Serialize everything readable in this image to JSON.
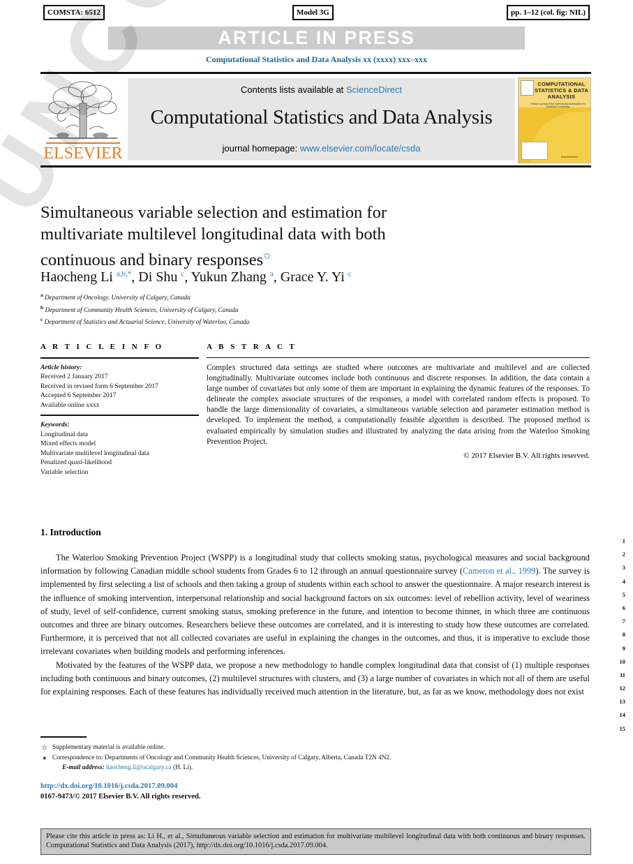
{
  "stamps": {
    "left": "COMSTA: 6512",
    "middle": "Model 3G",
    "right": "pp. 1–12 (col. fig: NIL)"
  },
  "banner": {
    "text": "ARTICLE IN PRESS",
    "journal_ref": "Computational Statistics and Data Analysis xx (xxxx) xxx–xxx"
  },
  "masthead": {
    "contents_prefix": "Contents lists available at ",
    "contents_link": "ScienceDirect",
    "journal_title": "Computational Statistics and Data Analysis",
    "homepage_prefix": "journal homepage: ",
    "homepage_link": "www.elsevier.com/locate/csda",
    "publisher": "ELSEVIER",
    "cover_title": "COMPUTATIONAL STATISTICS & DATA ANALYSIS",
    "cover_sub": "Official Journal of the International Association for Statistical Computing",
    "cover_foot": "ScienceDirect"
  },
  "article": {
    "title": "Simultaneous variable selection and estimation for multivariate multilevel longitudinal data with both continuous and binary responses",
    "title_marker": "✩",
    "authors_html": "Haocheng Li <sup>a,b,*</sup>, Di Shu <sup>c</sup>, Yukun Zhang <sup>a</sup>, Grace Y. Yi <sup>c</sup>",
    "affiliations": [
      {
        "mark": "a",
        "text": "Department of Oncology, University of Calgary, Canada"
      },
      {
        "mark": "b",
        "text": "Department of Community Health Sciences, University of Calgary, Canada"
      },
      {
        "mark": "c",
        "text": "Department of Statistics and Actuarial Science, University of Waterloo, Canada"
      }
    ]
  },
  "info": {
    "heading": "A R T I C L E   I N F O",
    "history_label": "Article history:",
    "history": [
      "Received 2 January 2017",
      "Received in revised form 6 September 2017",
      "Accepted 6 September 2017",
      "Available online xxxx"
    ],
    "keywords_label": "Keywords:",
    "keywords": [
      "Longitudinal data",
      "Mixed effects model",
      "Multivariate multilevel longitudinal data",
      "Penalized quasi-likelihood",
      "Variable selection"
    ]
  },
  "abstract": {
    "heading": "A B S T R A C T",
    "text": "Complex structured data settings are studied where outcomes are multivariate and multilevel and are collected longitudinally. Multivariate outcomes include both continuous and discrete responses. In addition, the data contain a large number of covariates but only some of them are important in explaining the dynamic features of the responses. To delineate the complex associate structures of the responses, a model with correlated random effects is proposed. To handle the large dimensionality of covariates, a simultaneous variable selection and parameter estimation method is developed. To implement the method, a computationally feasible algorithm is described. The proposed method is evaluated empirically by simulation studies and illustrated by analyzing the data arising from the Waterloo Smoking Prevention Project.",
    "copyright": "© 2017 Elsevier B.V. All rights reserved."
  },
  "body": {
    "section_title": "1. Introduction",
    "paragraph1_a": "The Waterloo Smoking Prevention Project (WSPP) is a longitudinal study that collects smoking status, psychological measures and social background information by following Canadian middle school students from Grades 6 to 12 through an annual questionnaire survey  (",
    "paragraph1_cite": "Cameron et al., 1999",
    "paragraph1_b": "). The survey is implemented by first selecting a list of schools and then taking a group of students within each school to answer the questionnaire. A major research interest is the influence of smoking intervention, interpersonal relationship and social background factors on six outcomes: level of rebellion activity, level of weariness of study, level of self-confidence, current smoking status, smoking preference in the future, and intention to become thinner, in which three are continuous outcomes and three are binary outcomes. Researchers believe these outcomes are correlated, and it is interesting to study how these outcomes are correlated. Furthermore, it is perceived that not all collected covariates are useful in explaining the changes in the outcomes, and thus, it is imperative to exclude those irrelevant covariates when building models and performing inferences.",
    "paragraph2": "Motivated by the features of the WSPP data, we propose a new methodology to handle complex longitudinal data that consist of (1) multiple responses including both continuous and binary outcomes, (2) multilevel structures with clusters, and (3) a large number of covariates in which not all of them are useful for explaining responses. Each of these features has individually received much attention in the literature, but, as far as we know, methodology does not exist",
    "line_numbers": [
      "1",
      "2",
      "3",
      "4",
      "5",
      "6",
      "7",
      "8",
      "9",
      "10",
      "11",
      "12",
      "13",
      "14",
      "15"
    ]
  },
  "footnotes": {
    "star_mark": "✩",
    "star_text": "Supplementary material is available online.",
    "corr_mark": "∗",
    "corr_text": "Correspondence to: Departments of Oncology and Community Health Sciences, University of Calgary, Alberta, Canada T2N 4N2.",
    "email_label": "E-mail address:",
    "email": "haocheng.li@ucalgary.ca",
    "email_suffix": "(H. Li).",
    "doi": "http://dx.doi.org/10.1016/j.csda.2017.09.004",
    "issn": "0167-9473/© 2017 Elsevier B.V. All rights reserved."
  },
  "cite_box": {
    "text": "Please cite this article in press as: Li H., et al., Simultaneous variable selection and estimation for multivariate multilevel longitudinal data with both continuous and binary responses. Computational Statistics and Data Analysis (2017), http://dx.doi.org/10.1016/j.csda.2017.09.004."
  },
  "watermark": {
    "text": "UNCORRECTED PROOF"
  },
  "colors": {
    "link": "#2a7ab0",
    "banner_bg": "#cccccc",
    "masthead_bg": "#e6e6e6",
    "elsevier_orange": "#e87a1e",
    "cover_yellow": "#f2c230"
  }
}
